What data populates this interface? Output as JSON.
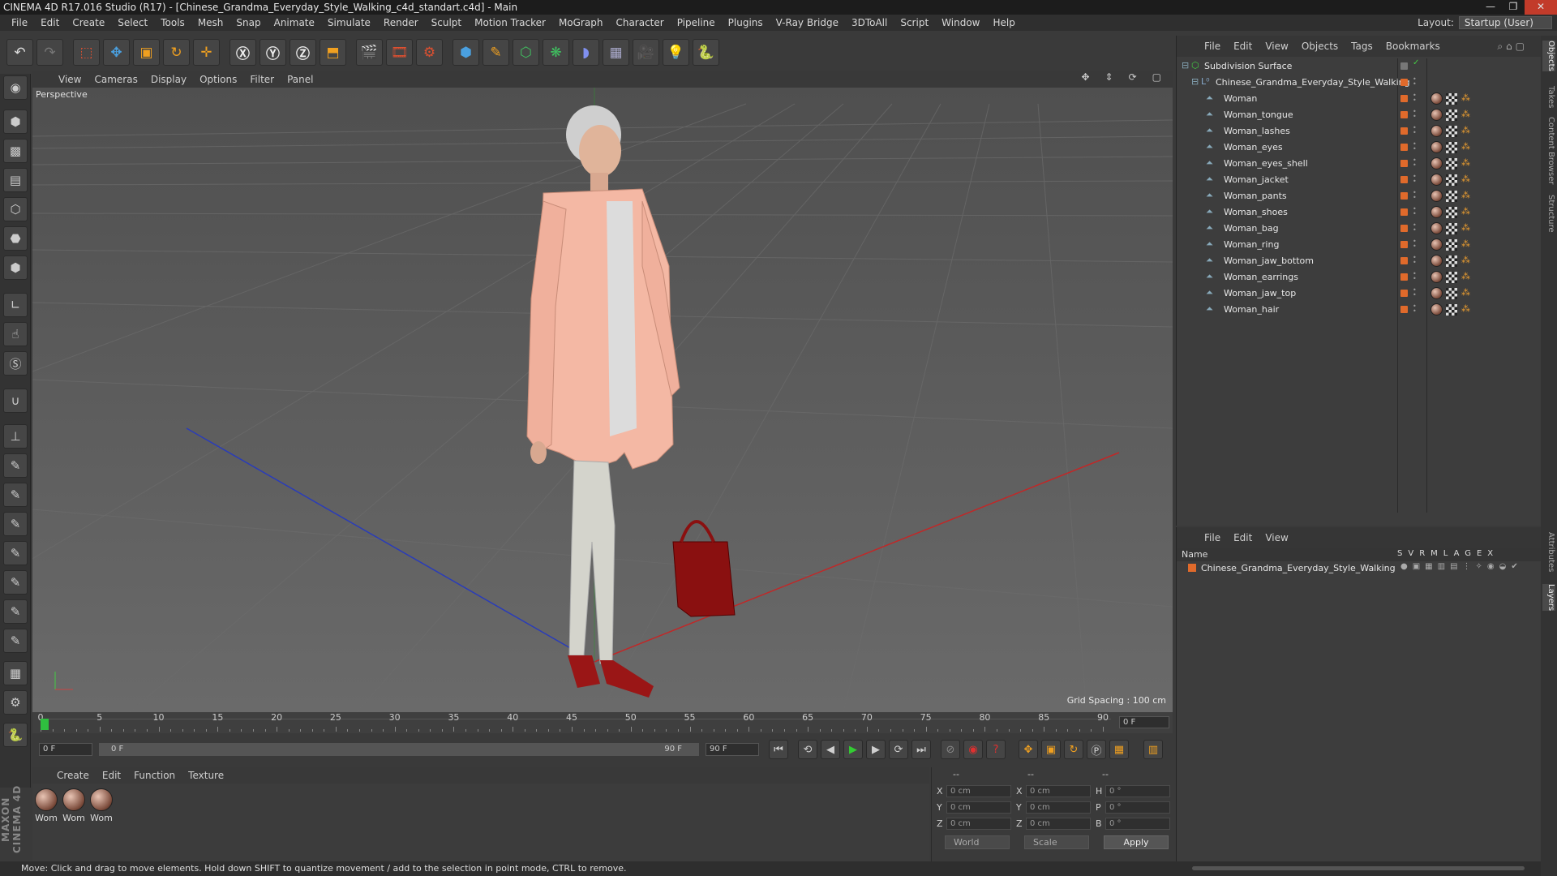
{
  "window": {
    "title": "CINEMA 4D R17.016 Studio (R17) - [Chinese_Grandma_Everyday_Style_Walking_c4d_standart.c4d] - Main"
  },
  "menu": [
    "File",
    "Edit",
    "Create",
    "Select",
    "Tools",
    "Mesh",
    "Snap",
    "Animate",
    "Simulate",
    "Render",
    "Sculpt",
    "Motion Tracker",
    "MoGraph",
    "Character",
    "Pipeline",
    "Plugins",
    "V-Ray Bridge",
    "3DToAll",
    "Script",
    "Window",
    "Help"
  ],
  "layout": {
    "label": "Layout:",
    "value": "Startup (User)"
  },
  "viewport": {
    "menu": [
      "View",
      "Cameras",
      "Display",
      "Options",
      "Filter",
      "Panel"
    ],
    "label": "Perspective",
    "grid_spacing": "Grid Spacing : 100 cm"
  },
  "timeline": {
    "ticks": [
      "0",
      "5",
      "10",
      "15",
      "20",
      "25",
      "30",
      "35",
      "40",
      "45",
      "50",
      "55",
      "60",
      "65",
      "70",
      "75",
      "80",
      "85",
      "90"
    ],
    "current_frame": "0 F"
  },
  "playback": {
    "start": "0 F",
    "range_start": "0 F",
    "range_end": "90 F",
    "end": "90 F"
  },
  "materials": {
    "menu": [
      "Create",
      "Edit",
      "Function",
      "Texture"
    ],
    "items": [
      "Wom",
      "Wom",
      "Wom"
    ]
  },
  "coords": {
    "header": [
      "--",
      "--",
      "--"
    ],
    "rows": [
      {
        "a": "X",
        "av": "0 cm",
        "b": "X",
        "bv": "0 cm",
        "c": "H",
        "cv": "0 °"
      },
      {
        "a": "Y",
        "av": "0 cm",
        "b": "Y",
        "bv": "0 cm",
        "c": "P",
        "cv": "0 °"
      },
      {
        "a": "Z",
        "av": "0 cm",
        "b": "Z",
        "bv": "0 cm",
        "c": "B",
        "cv": "0 °"
      }
    ],
    "mode1": "World",
    "mode2": "Scale",
    "apply": "Apply"
  },
  "status": "Move: Click and drag to move elements. Hold down SHIFT to quantize movement / add to the selection in point mode, CTRL to remove.",
  "objects": {
    "menu": [
      "File",
      "Edit",
      "View",
      "Objects",
      "Tags",
      "Bookmarks"
    ],
    "root": "Subdivision Surface",
    "group": "Chinese_Grandma_Everyday_Style_Walking",
    "items": [
      "Woman",
      "Woman_tongue",
      "Woman_lashes",
      "Woman_eyes",
      "Woman_eyes_shell",
      "Woman_jacket",
      "Woman_pants",
      "Woman_shoes",
      "Woman_bag",
      "Woman_ring",
      "Woman_jaw_bottom",
      "Woman_earrings",
      "Woman_jaw_top",
      "Woman_hair"
    ]
  },
  "layers": {
    "menu": [
      "File",
      "Edit",
      "View"
    ],
    "name_header": "Name",
    "cols": "SVRMLAGEX",
    "row": "Chinese_Grandma_Everyday_Style_Walking"
  },
  "side_tabs": [
    "Objects",
    "Takes",
    "Content Browser",
    "Structure",
    "Attributes",
    "Layers"
  ],
  "colors": {
    "accent": "#e06a2b",
    "viewport_bg": "#5c5c5c",
    "x_axis": "#c02020",
    "z_axis": "#2030c0"
  }
}
